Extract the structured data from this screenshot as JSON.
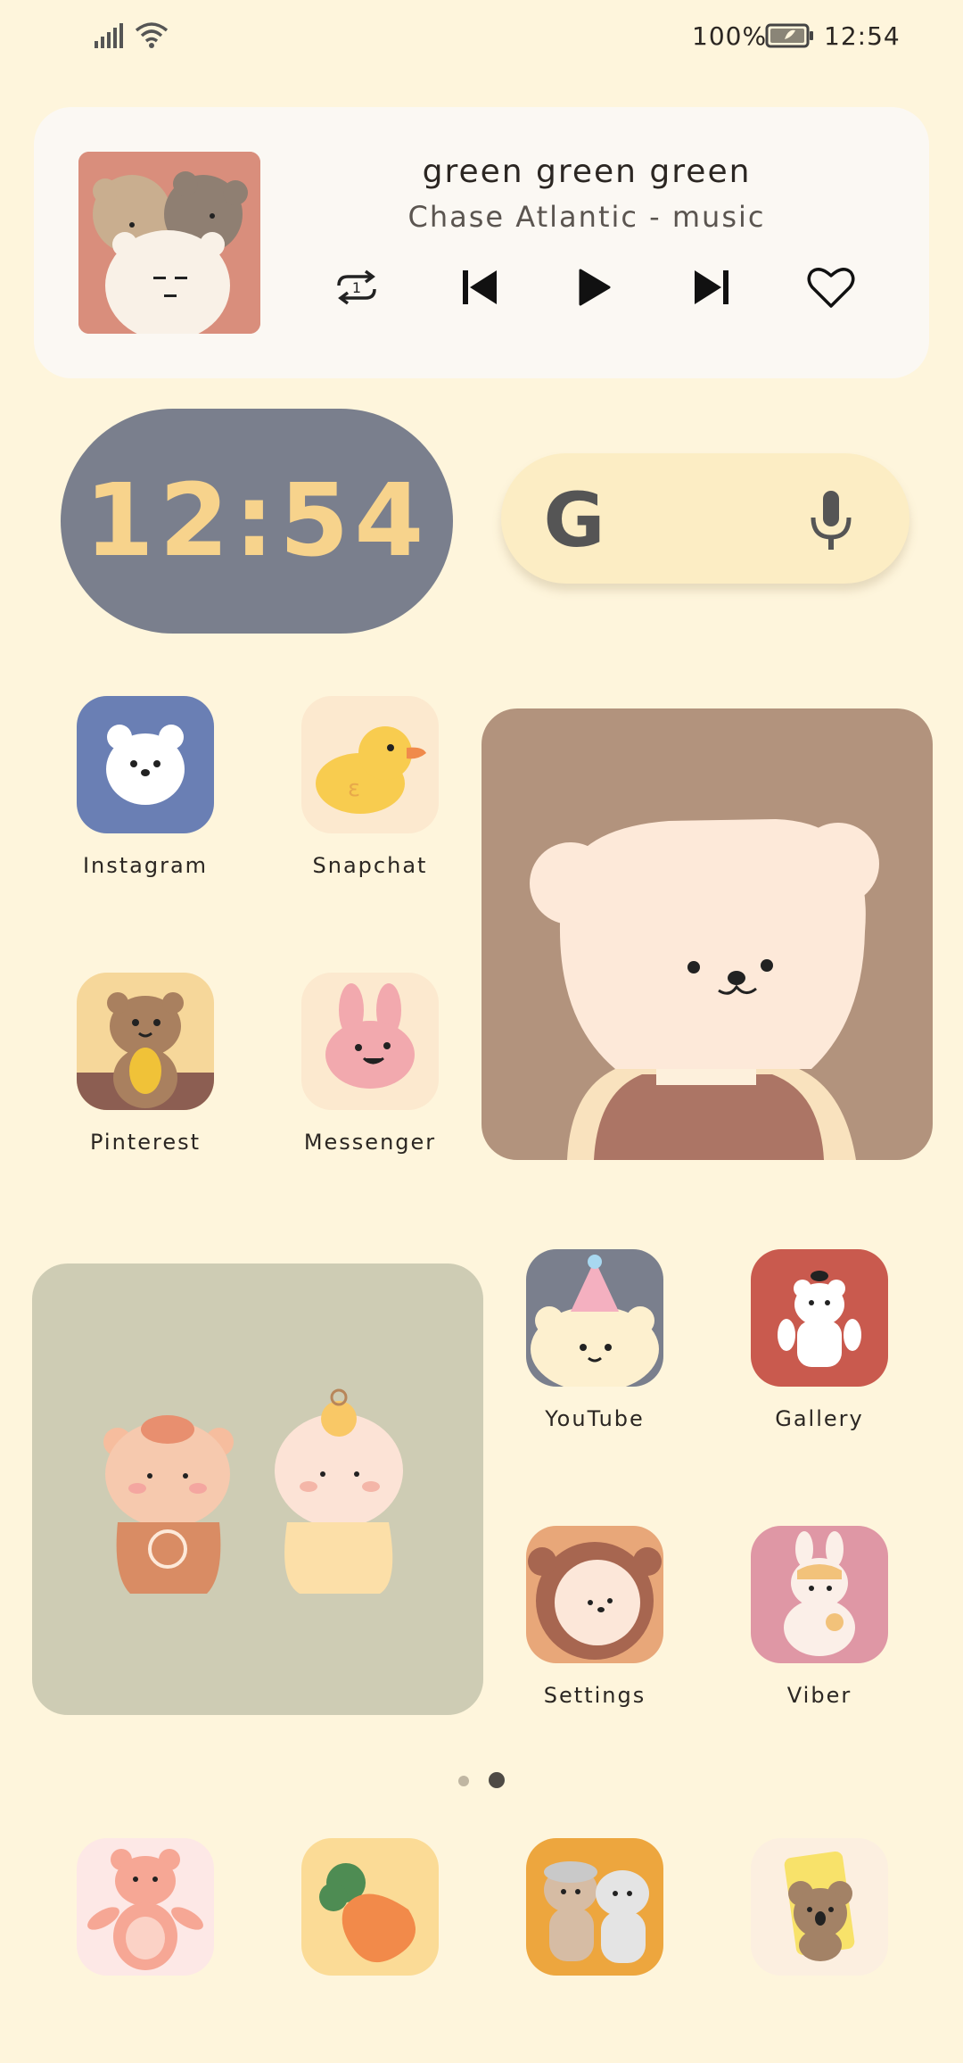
{
  "status_bar": {
    "battery_percent": "100%",
    "time": "12:54"
  },
  "music_widget": {
    "title": "green green green",
    "artist": "Chase Atlantic  - music",
    "album_art_icon": "bear-trio-icon",
    "controls": {
      "repeat_badge": "1"
    }
  },
  "clock_widget": {
    "time": "12:54",
    "colors": {
      "background": "#7A7F8D",
      "digits": "#F7D38C"
    }
  },
  "search_widget": {
    "logo_letter": "G"
  },
  "apps": [
    {
      "label": "Instagram",
      "icon": "white-bear-icon",
      "bg": "#6A7FB4"
    },
    {
      "label": "Snapchat",
      "icon": "rubber-duck-icon",
      "bg": "#FCE9CF"
    },
    {
      "label": "Pinterest",
      "icon": "quokka-icon",
      "bg": "#F6D79A"
    },
    {
      "label": "Messenger",
      "icon": "pink-bunny-icon",
      "bg": "#FCE9CF"
    },
    {
      "label": "YouTube",
      "icon": "party-bear-icon",
      "bg": "#7A7F8D"
    },
    {
      "label": "Gallery",
      "icon": "white-bear-red-icon",
      "bg": "#C95A4E"
    },
    {
      "label": "Settings",
      "icon": "lion-bear-icon",
      "bg": "#E8A779"
    },
    {
      "label": "Viber",
      "icon": "bunny-girl-icon",
      "bg": "#DF97A5"
    }
  ],
  "page_indicator": {
    "pages": 2,
    "current": 2
  },
  "dock": [
    {
      "icon": "pink-bear-icon",
      "bg": "#FDE8E6"
    },
    {
      "icon": "carrot-icon",
      "bg": "#FBDB96"
    },
    {
      "icon": "bear-friends-icon",
      "bg": "#EDA63E"
    },
    {
      "icon": "koala-icon",
      "bg": "#FCEFE0"
    }
  ]
}
